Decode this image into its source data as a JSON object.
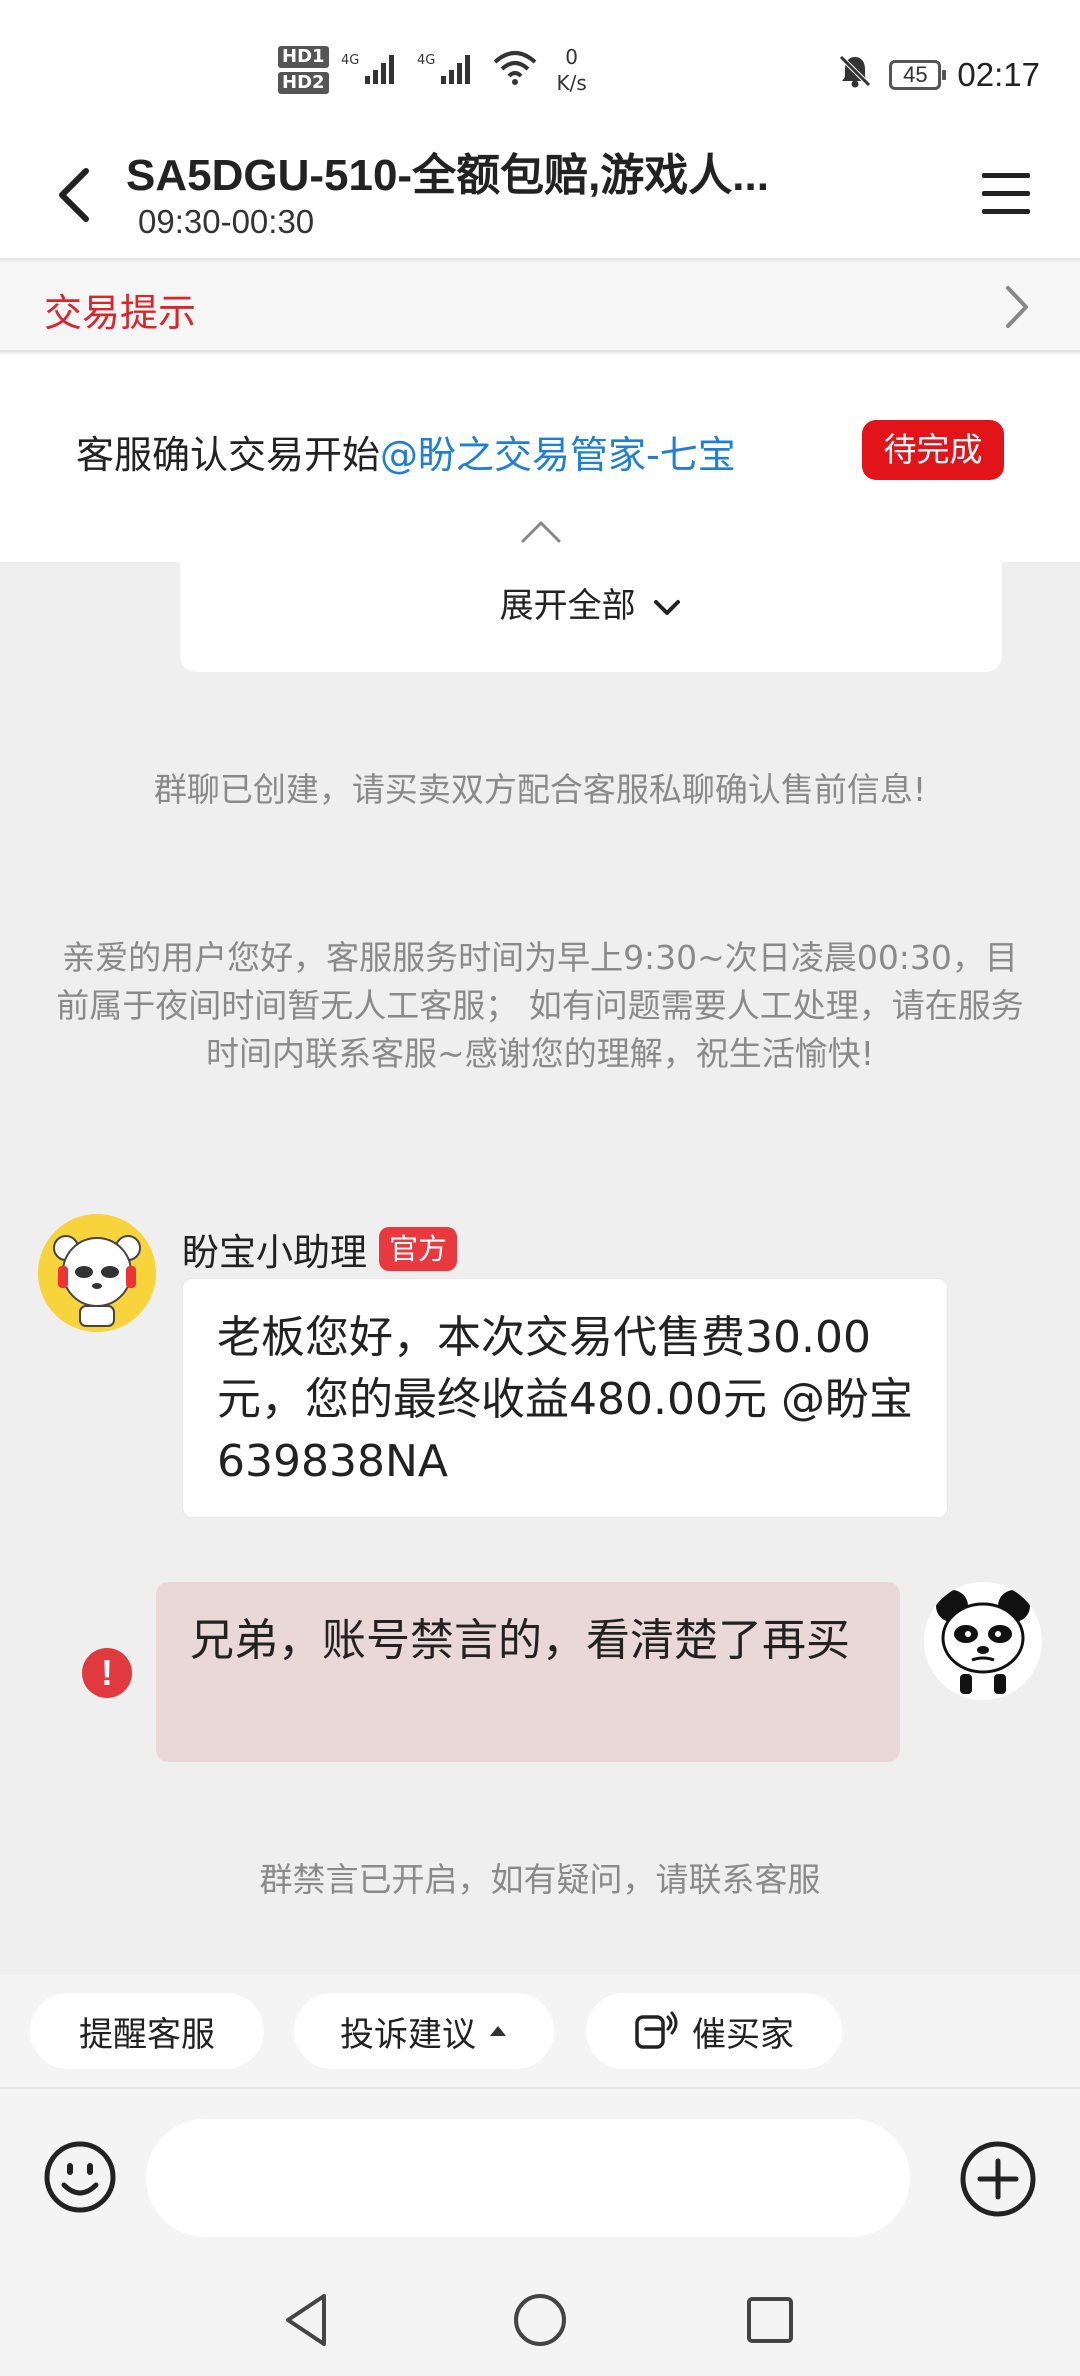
{
  "status_bar": {
    "hd1": "HD1",
    "hd2": "HD2",
    "signal1": "4G",
    "signal2": "4G",
    "net_speed_value": "0",
    "net_speed_unit": "K/s",
    "battery": "45",
    "time": "02:17",
    "icons": [
      "signal-icon",
      "wifi-icon",
      "mute-bell-icon",
      "battery-icon"
    ]
  },
  "header": {
    "title": "SA5DGU-510-全额包赔,游戏人...",
    "subtitle": "09:30-00:30"
  },
  "tips_bar": {
    "label": "交易提示"
  },
  "notice": {
    "text": "客服确认交易开始",
    "mention": "@盼之交易管家-七宝",
    "badge": "待完成"
  },
  "card": {
    "expand_label": "展开全部"
  },
  "system_messages": {
    "group_created": "群聊已创建，请买卖双方配合客服私聊确认售前信息!",
    "service_hours": "亲爱的用户您好，客服服务时间为早上9:30~次日凌晨00:30，目前属于夜间时间暂无人工客服； 如有问题需要人工处理，请在服务时间内联系客服~感谢您的理解，祝生活愉快!",
    "muted": "群禁言已开启，如有疑问，请联系客服"
  },
  "messages": [
    {
      "sender": "盼宝小助理",
      "badge": "官方",
      "text": "老板您好，本次交易代售费30.00元，您的最终收益480.00元 @盼宝639838NA"
    },
    {
      "text": "兄弟，账号禁言的，看清楚了再买",
      "error_mark": "!"
    }
  ],
  "quick_actions": {
    "remind": "提醒客服",
    "complaint": "投诉建议",
    "urge": "催买家"
  },
  "input": {
    "placeholder": ""
  },
  "colors": {
    "accent_red": "#d8262b",
    "badge_red": "#e2141a",
    "mention_blue": "#1f7fd8",
    "error_bubble": "#ead8d9"
  }
}
